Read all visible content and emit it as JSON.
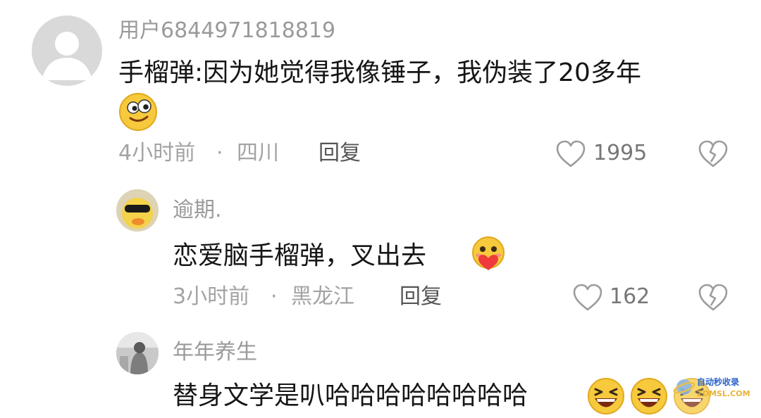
{
  "comments": [
    {
      "username": "用户6844971818819",
      "text": "手榴弹:因为她觉得我像锤子，我伪装了20多年",
      "emoji": "sly-smirk-emoji",
      "time": "4小时前",
      "location": "四川",
      "reply_label": "回复",
      "likes": "1995"
    },
    {
      "username": "逾期.",
      "text": "恋爱脑手榴弹，叉出去",
      "emoji": "heart-hug-emoji",
      "time": "3小时前",
      "location": "黑龙江",
      "reply_label": "回复",
      "likes": "162"
    },
    {
      "username": "年年养生",
      "text": "替身文学是叭哈哈哈哈哈哈哈哈",
      "emoji": "laughing-emoji"
    }
  ],
  "meta_separator": "·",
  "watermark": {
    "line1": "自动秒收录",
    "line2": "ZDMSL.COM"
  }
}
